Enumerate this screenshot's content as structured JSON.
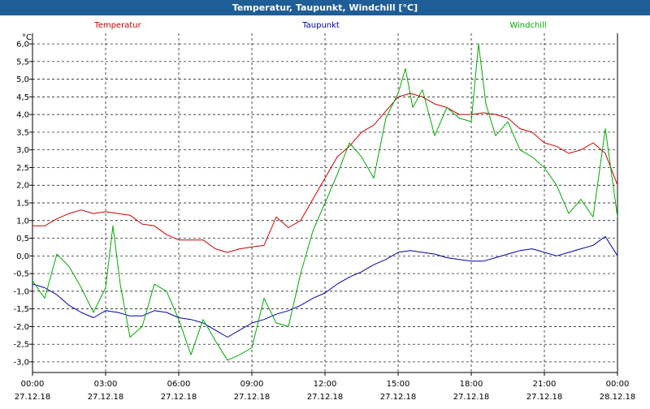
{
  "window": {
    "title": "Temperatur, Taupunkt, Windchill [°C]"
  },
  "chart_data": {
    "type": "line",
    "unit_label": "°C",
    "ylim": [
      -3.3,
      6.3
    ],
    "yticks": [
      -3.0,
      -2.5,
      -2.0,
      -1.5,
      -1.0,
      -0.5,
      0.0,
      0.5,
      1.0,
      1.5,
      2.0,
      2.5,
      3.0,
      3.5,
      4.0,
      4.5,
      5.0,
      5.5,
      6.0
    ],
    "ytick_labels": [
      "-3,0",
      "-2,5",
      "-2,0",
      "-1,5",
      "-1,0",
      "-0,5",
      "0,0",
      "0,5",
      "1,0",
      "1,5",
      "2,0",
      "2,5",
      "3,0",
      "3,5",
      "4,0",
      "4,5",
      "5,0",
      "5,5",
      "6,0"
    ],
    "xlim": [
      0,
      24
    ],
    "xticks": [
      {
        "x": 0,
        "time": "00:00",
        "date": "27.12.18"
      },
      {
        "x": 3,
        "time": "03:00",
        "date": "27.12.18"
      },
      {
        "x": 6,
        "time": "06:00",
        "date": "27.12.18"
      },
      {
        "x": 9,
        "time": "09:00",
        "date": "27.12.18"
      },
      {
        "x": 12,
        "time": "12:00",
        "date": "27.12.18"
      },
      {
        "x": 15,
        "time": "15:00",
        "date": "27.12.18"
      },
      {
        "x": 18,
        "time": "18:00",
        "date": "27.12.18"
      },
      {
        "x": 21,
        "time": "21:00",
        "date": "27.12.18"
      },
      {
        "x": 24,
        "time": "00:00",
        "date": "28.12.18"
      }
    ],
    "grid": true,
    "series": [
      {
        "name": "Temperatur",
        "color": "#cc0000",
        "points": [
          [
            0,
            0.85
          ],
          [
            0.5,
            0.85
          ],
          [
            1,
            1.05
          ],
          [
            1.5,
            1.2
          ],
          [
            2,
            1.3
          ],
          [
            2.5,
            1.2
          ],
          [
            3,
            1.25
          ],
          [
            3.5,
            1.2
          ],
          [
            4,
            1.15
          ],
          [
            4.5,
            0.9
          ],
          [
            5,
            0.85
          ],
          [
            5.5,
            0.6
          ],
          [
            6,
            0.45
          ],
          [
            6.5,
            0.45
          ],
          [
            7,
            0.45
          ],
          [
            7.5,
            0.2
          ],
          [
            8,
            0.1
          ],
          [
            8.5,
            0.2
          ],
          [
            9,
            0.25
          ],
          [
            9.5,
            0.3
          ],
          [
            10,
            1.1
          ],
          [
            10.5,
            0.8
          ],
          [
            11,
            1.0
          ],
          [
            11.5,
            1.6
          ],
          [
            12,
            2.2
          ],
          [
            12.5,
            2.8
          ],
          [
            13,
            3.1
          ],
          [
            13.5,
            3.5
          ],
          [
            14,
            3.7
          ],
          [
            14.5,
            4.1
          ],
          [
            15,
            4.5
          ],
          [
            15.5,
            4.6
          ],
          [
            16,
            4.5
          ],
          [
            16.5,
            4.3
          ],
          [
            17,
            4.2
          ],
          [
            17.5,
            4.0
          ],
          [
            18,
            4.0
          ],
          [
            18.5,
            4.05
          ],
          [
            19,
            4.0
          ],
          [
            19.5,
            3.9
          ],
          [
            20,
            3.6
          ],
          [
            20.5,
            3.5
          ],
          [
            21,
            3.2
          ],
          [
            21.5,
            3.1
          ],
          [
            22,
            2.9
          ],
          [
            22.5,
            3.0
          ],
          [
            23,
            3.2
          ],
          [
            23.5,
            2.9
          ],
          [
            24,
            2.0
          ]
        ]
      },
      {
        "name": "Taupunkt",
        "color": "#0000aa",
        "points": [
          [
            0,
            -0.8
          ],
          [
            0.5,
            -0.9
          ],
          [
            1,
            -1.1
          ],
          [
            1.5,
            -1.4
          ],
          [
            2,
            -1.6
          ],
          [
            2.5,
            -1.75
          ],
          [
            3,
            -1.55
          ],
          [
            3.5,
            -1.6
          ],
          [
            4,
            -1.7
          ],
          [
            4.5,
            -1.7
          ],
          [
            5,
            -1.55
          ],
          [
            5.5,
            -1.6
          ],
          [
            6,
            -1.75
          ],
          [
            6.5,
            -1.8
          ],
          [
            7,
            -1.9
          ],
          [
            7.5,
            -2.1
          ],
          [
            8,
            -2.3
          ],
          [
            8.5,
            -2.1
          ],
          [
            9,
            -1.9
          ],
          [
            9.5,
            -1.8
          ],
          [
            10,
            -1.65
          ],
          [
            10.5,
            -1.55
          ],
          [
            11,
            -1.4
          ],
          [
            11.5,
            -1.2
          ],
          [
            12,
            -1.05
          ],
          [
            12.5,
            -0.8
          ],
          [
            13,
            -0.6
          ],
          [
            13.5,
            -0.45
          ],
          [
            14,
            -0.25
          ],
          [
            14.5,
            -0.1
          ],
          [
            15,
            0.1
          ],
          [
            15.5,
            0.15
          ],
          [
            16,
            0.1
          ],
          [
            16.5,
            0.05
          ],
          [
            17,
            -0.05
          ],
          [
            17.5,
            -0.1
          ],
          [
            18,
            -0.15
          ],
          [
            18.5,
            -0.15
          ],
          [
            19,
            -0.05
          ],
          [
            19.5,
            0.05
          ],
          [
            20,
            0.15
          ],
          [
            20.5,
            0.2
          ],
          [
            21,
            0.1
          ],
          [
            21.5,
            0.0
          ],
          [
            22,
            0.1
          ],
          [
            22.5,
            0.2
          ],
          [
            23,
            0.3
          ],
          [
            23.5,
            0.55
          ],
          [
            24,
            0.0
          ]
        ]
      },
      {
        "name": "Windchill",
        "color": "#00aa00",
        "points": [
          [
            0,
            -0.7
          ],
          [
            0.5,
            -1.2
          ],
          [
            1,
            0.05
          ],
          [
            1.5,
            -0.3
          ],
          [
            2,
            -0.9
          ],
          [
            2.5,
            -1.6
          ],
          [
            3,
            -0.9
          ],
          [
            3.3,
            0.85
          ],
          [
            3.6,
            -0.8
          ],
          [
            4,
            -2.3
          ],
          [
            4.5,
            -2.0
          ],
          [
            5,
            -0.8
          ],
          [
            5.5,
            -1.0
          ],
          [
            6,
            -1.8
          ],
          [
            6.5,
            -2.8
          ],
          [
            7,
            -1.8
          ],
          [
            7.5,
            -2.4
          ],
          [
            8,
            -2.95
          ],
          [
            8.5,
            -2.8
          ],
          [
            9,
            -2.6
          ],
          [
            9.5,
            -1.2
          ],
          [
            10,
            -1.9
          ],
          [
            10.5,
            -2.0
          ],
          [
            11,
            -0.5
          ],
          [
            11.5,
            0.7
          ],
          [
            12,
            1.5
          ],
          [
            12.5,
            2.3
          ],
          [
            13,
            3.2
          ],
          [
            13.5,
            2.8
          ],
          [
            14,
            2.2
          ],
          [
            14.5,
            3.9
          ],
          [
            15,
            4.6
          ],
          [
            15.3,
            5.3
          ],
          [
            15.6,
            4.2
          ],
          [
            16,
            4.7
          ],
          [
            16.5,
            3.4
          ],
          [
            17,
            4.2
          ],
          [
            17.5,
            3.9
          ],
          [
            18,
            3.8
          ],
          [
            18.3,
            6.0
          ],
          [
            18.6,
            4.3
          ],
          [
            19,
            3.4
          ],
          [
            19.5,
            3.8
          ],
          [
            20,
            3.0
          ],
          [
            20.5,
            2.8
          ],
          [
            21,
            2.5
          ],
          [
            21.5,
            2.0
          ],
          [
            22,
            1.2
          ],
          [
            22.5,
            1.6
          ],
          [
            23,
            1.1
          ],
          [
            23.5,
            3.6
          ],
          [
            24,
            1.1
          ]
        ]
      }
    ]
  }
}
